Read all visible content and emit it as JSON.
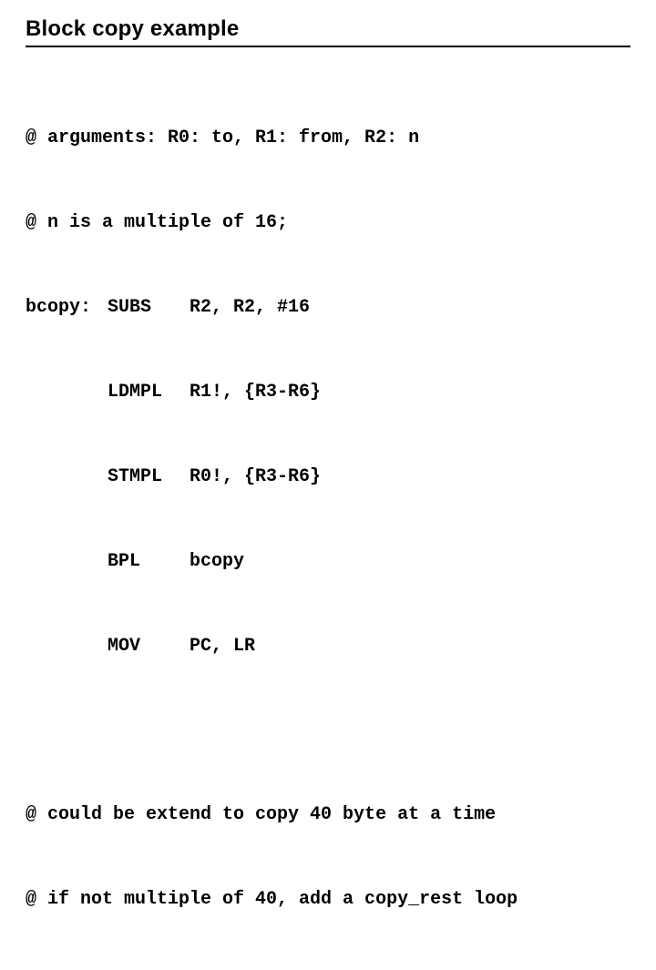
{
  "title": "Block copy example",
  "comments": {
    "args": "@ arguments: R0: to, R1: from, R2: n",
    "mult": "@ n is a multiple of 16;",
    "ext1": "@ could be extend to copy 40 byte at a time",
    "ext2": "@ if not multiple of 40, add a copy_rest loop"
  },
  "label": "bcopy:",
  "instr": [
    {
      "m": "SUBS",
      "ops": "R2, R2, #16"
    },
    {
      "m": "LDMPL",
      "ops": "R1!, {R3-R6}"
    },
    {
      "m": "STMPL",
      "ops": "R0!, {R3-R6}"
    },
    {
      "m": "BPL",
      "ops": "bcopy"
    },
    {
      "m": "MOV",
      "ops": "PC, LR"
    }
  ]
}
